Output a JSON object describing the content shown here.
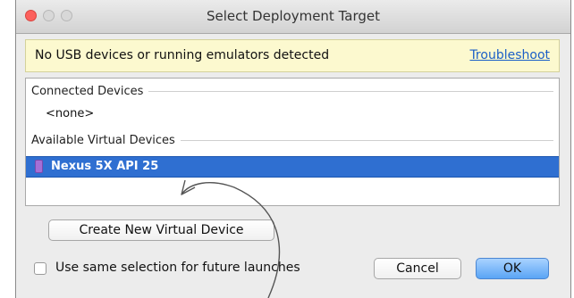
{
  "window": {
    "title": "Select Deployment Target"
  },
  "banner": {
    "message": "No USB devices or running emulators detected",
    "link_label": "Troubleshoot"
  },
  "device_list": {
    "connected_header": "Connected Devices",
    "connected_items": [
      "<none>"
    ],
    "available_header": "Available Virtual Devices",
    "available_items": [
      {
        "label": "Nexus 5X API 25",
        "icon": "phone-icon",
        "selected": true
      }
    ]
  },
  "buttons": {
    "create": "Create New Virtual Device",
    "cancel": "Cancel",
    "ok": "OK"
  },
  "options": {
    "same_selection_label": "Use same selection for future launches",
    "same_selection_checked": false
  },
  "colors": {
    "banner_bg": "#fcf9cf",
    "selection": "#2f6fd1",
    "link": "#1b5fc7",
    "ok_button": "#5aa5f5",
    "device_icon": "#a56fd6"
  }
}
